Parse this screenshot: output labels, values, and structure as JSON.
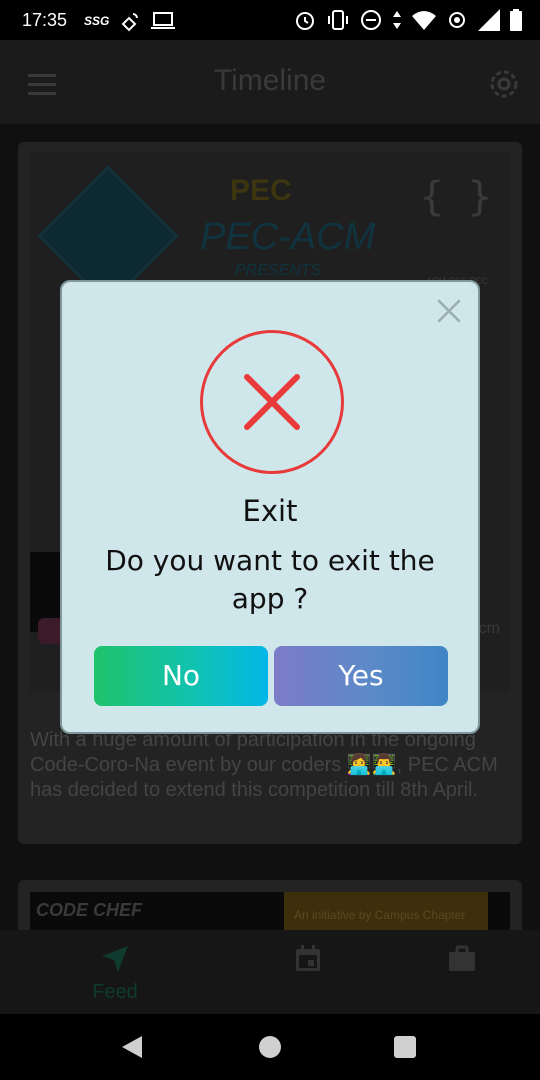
{
  "status_bar": {
    "time": "17:35",
    "left_icons": [
      "ssg-label",
      "satellite-icon",
      "laptop-icon"
    ],
    "ssg_label": "SSG",
    "right_icons": [
      "alarm-icon",
      "vibrate-icon",
      "dnd-icon",
      "data-arrows-icon",
      "wifi-icon",
      "hotspot-icon",
      "signal-icon",
      "battery-icon"
    ]
  },
  "app_bar": {
    "title": "Timeline"
  },
  "post": {
    "poster": {
      "pec_text": "PEC",
      "acm_text": "PEC-ACM",
      "presents_text": "PRESENTS",
      "logo_text": "acm",
      "braces_text": "{ }",
      "braces_label": "ACM CSS PEC",
      "cm_text": "cm"
    },
    "text": "With a huge amount of participation in the ongoing Code-Coro-Na event by our coders 👩‍💻👨‍💻, PEC ACM has decided to extend this competition till 8th April."
  },
  "post2": {
    "banner_left": "CODE CHEF",
    "banner_right": "An initiative by Campus Chapter"
  },
  "bottom_nav": {
    "items": [
      {
        "label": "Feed",
        "icon": "navigation-arrow-icon"
      },
      {
        "label": "",
        "icon": "calendar-icon"
      },
      {
        "label": "",
        "icon": "briefcase-icon"
      }
    ]
  },
  "dialog": {
    "title": "Exit",
    "message": "Do you want to exit the app ?",
    "no_label": "No",
    "yes_label": "Yes",
    "status_icon": "error-x-icon",
    "colors": {
      "background": "#cfe6ea",
      "error": "#e83a3a",
      "no_gradient": [
        "#1fc36a",
        "#02b6e8"
      ],
      "yes_gradient": [
        "#7d7bc8",
        "#3f86c7"
      ]
    }
  }
}
